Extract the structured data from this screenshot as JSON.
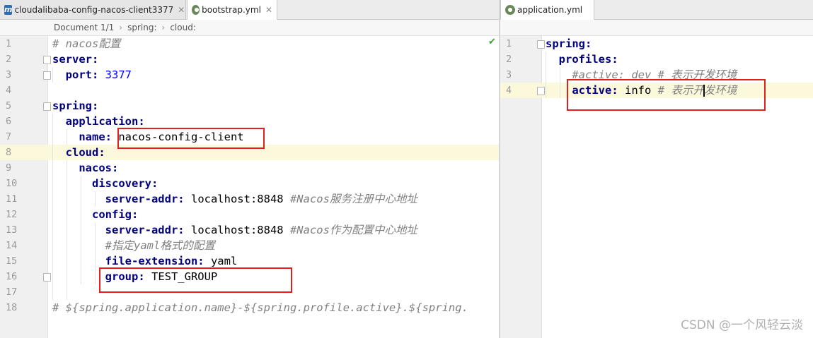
{
  "left_tabs": [
    {
      "label": "cloudalibaba-config-nacos-client3377",
      "icon": "module-m-icon",
      "close": "✕"
    },
    {
      "label": "bootstrap.yml",
      "icon": "yml-file-icon",
      "close": "✕"
    }
  ],
  "right_tabs": [
    {
      "label": "application.yml",
      "icon": "yml-file-icon",
      "close": "✕"
    }
  ],
  "breadcrumb": {
    "items": [
      "Document 1/1",
      "spring:",
      "cloud:"
    ],
    "separator": "›"
  },
  "left_lines": [
    {
      "n": "1",
      "parts": [
        [
          "cm",
          "# "
        ],
        [
          "cm",
          "nacos"
        ],
        [
          "cm",
          "配置"
        ]
      ]
    },
    {
      "n": "2",
      "parts": [
        [
          "key",
          "server:"
        ]
      ]
    },
    {
      "n": "3",
      "parts": [
        [
          "sp",
          "  "
        ],
        [
          "key",
          "port: "
        ],
        [
          "num",
          "3377"
        ]
      ]
    },
    {
      "n": "4",
      "parts": []
    },
    {
      "n": "5",
      "parts": [
        [
          "key",
          "spring:"
        ]
      ]
    },
    {
      "n": "6",
      "parts": [
        [
          "sp",
          "  "
        ],
        [
          "key",
          "application:"
        ]
      ]
    },
    {
      "n": "7",
      "parts": [
        [
          "sp",
          "    "
        ],
        [
          "key",
          "name: "
        ],
        [
          "val",
          "nacos-config-client"
        ]
      ]
    },
    {
      "n": "8",
      "parts": [
        [
          "sp",
          "  "
        ],
        [
          "key",
          "cloud:"
        ]
      ]
    },
    {
      "n": "9",
      "parts": [
        [
          "sp",
          "    "
        ],
        [
          "key",
          "nacos:"
        ]
      ]
    },
    {
      "n": "10",
      "parts": [
        [
          "sp",
          "      "
        ],
        [
          "key",
          "discovery:"
        ]
      ]
    },
    {
      "n": "11",
      "parts": [
        [
          "sp",
          "        "
        ],
        [
          "key",
          "server-addr: "
        ],
        [
          "val",
          "localhost:8848 "
        ],
        [
          "cm",
          "#Nacos服务注册中心地址"
        ]
      ]
    },
    {
      "n": "12",
      "parts": [
        [
          "sp",
          "      "
        ],
        [
          "key",
          "config:"
        ]
      ]
    },
    {
      "n": "13",
      "parts": [
        [
          "sp",
          "        "
        ],
        [
          "key",
          "server-addr: "
        ],
        [
          "val",
          "localhost:8848 "
        ],
        [
          "cm",
          "#Nacos作为配置中心地址"
        ]
      ]
    },
    {
      "n": "14",
      "parts": [
        [
          "sp",
          "        "
        ],
        [
          "cm",
          "#指定yaml格式的配置"
        ]
      ]
    },
    {
      "n": "15",
      "parts": [
        [
          "sp",
          "        "
        ],
        [
          "key",
          "file-extension: "
        ],
        [
          "val",
          "yaml"
        ]
      ]
    },
    {
      "n": "16",
      "parts": [
        [
          "sp",
          "        "
        ],
        [
          "key",
          "group: "
        ],
        [
          "val",
          "TEST_GROUP"
        ]
      ]
    },
    {
      "n": "17",
      "parts": []
    },
    {
      "n": "18",
      "parts": [
        [
          "cm",
          "# ${spring.application.name}-${spring.profile.active}.${spring."
        ]
      ]
    }
  ],
  "right_lines": [
    {
      "n": "1",
      "parts": [
        [
          "key",
          "spring:"
        ]
      ]
    },
    {
      "n": "2",
      "parts": [
        [
          "sp",
          "  "
        ],
        [
          "key",
          "profiles:"
        ]
      ]
    },
    {
      "n": "3",
      "parts": [
        [
          "sp",
          "    "
        ],
        [
          "cm",
          "#active: dev # 表示开发环境"
        ]
      ]
    },
    {
      "n": "4",
      "parts": [
        [
          "sp",
          "    "
        ],
        [
          "key",
          "active: "
        ],
        [
          "val",
          "info "
        ],
        [
          "cm",
          "# 表示开"
        ],
        [
          "cursor",
          ""
        ],
        [
          "cm",
          "发环境"
        ]
      ]
    }
  ],
  "inspection_status": "✔",
  "watermark": "CSDN @一个风轻云淡",
  "colors": {
    "key": "#000080",
    "number": "#0000ff",
    "comment": "#808080",
    "highlight_box": "#e02020",
    "caret_row": "#fcf8dc"
  }
}
